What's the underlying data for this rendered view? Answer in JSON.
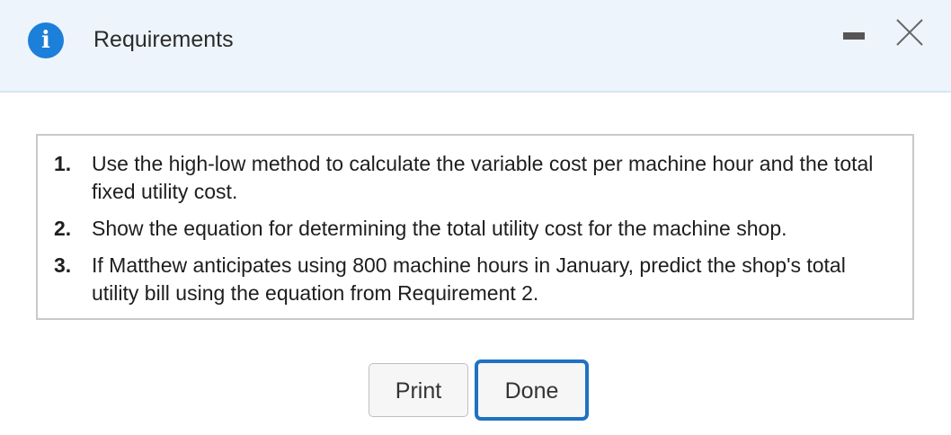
{
  "dialog": {
    "title": "Requirements",
    "info_glyph": "i",
    "minimize_icon": "minimize-icon",
    "close_icon": "close-icon"
  },
  "requirements": [
    {
      "number": "1.",
      "text": "Use the high-low method to calculate the variable cost per machine hour and the total fixed utility cost."
    },
    {
      "number": "2.",
      "text": "Show the equation for determining the total utility cost for the machine shop."
    },
    {
      "number": "3.",
      "text": "If Matthew anticipates using 800 machine hours in January, predict the shop's total utility bill using the equation from Requirement 2."
    }
  ],
  "buttons": {
    "print_label": "Print",
    "done_label": "Done"
  },
  "colors": {
    "titlebar_bg": "#eef4fb",
    "info_icon": "#1c7fd9",
    "focus_border": "#1f72c1"
  }
}
